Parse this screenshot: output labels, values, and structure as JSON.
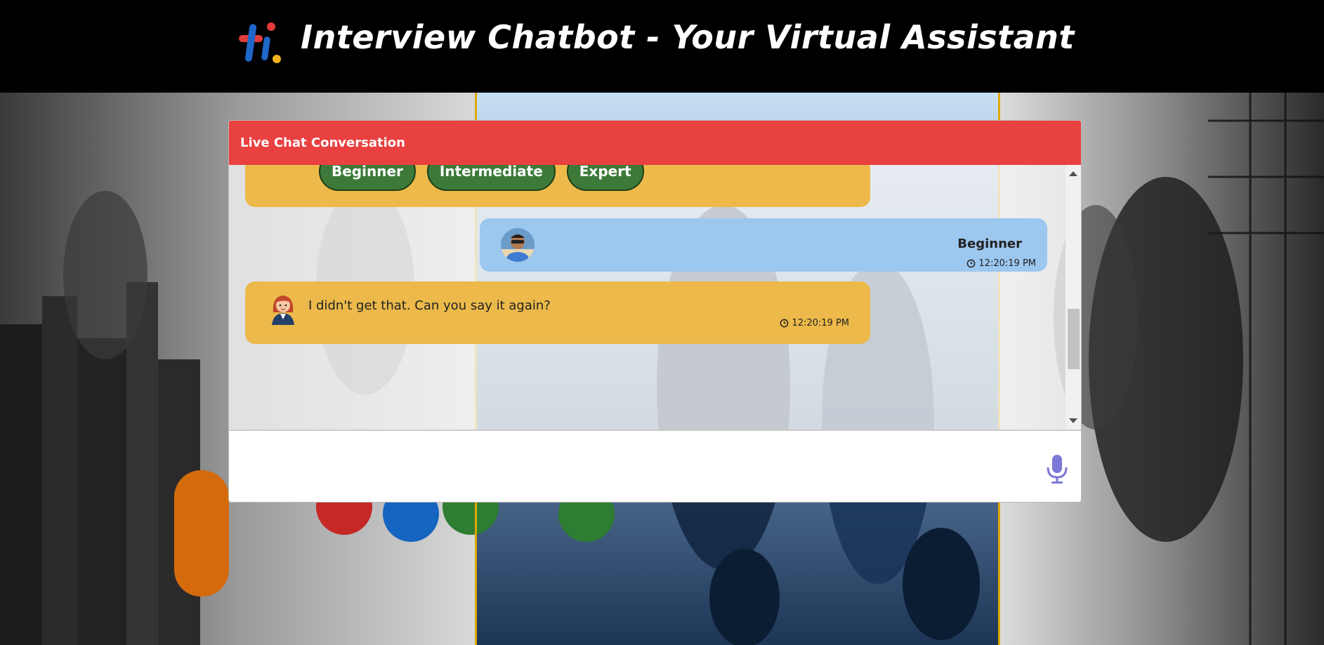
{
  "header": {
    "title": "Interview Chatbot - Your Virtual Assistant"
  },
  "chat": {
    "header_label": "Live Chat Conversation",
    "options": [
      {
        "label": "Beginner"
      },
      {
        "label": "Intermediate"
      },
      {
        "label": "Expert"
      }
    ],
    "messages": [
      {
        "sender": "user",
        "text": "Beginner",
        "time": "12:20:19 PM"
      },
      {
        "sender": "bot",
        "text": "I didn't get that. Can you say it again?",
        "time": "12:20:19 PM"
      }
    ],
    "input": {
      "value": "",
      "placeholder": ""
    }
  },
  "colors": {
    "header_bg": "#000000",
    "chat_header": "#e94040",
    "bot_bubble": "#ecb94a",
    "user_bubble": "#9cc7ef",
    "option_button": "#3d7a3a",
    "mic_icon": "#7b78d6"
  },
  "icons": {
    "logo": "hi-logo",
    "clock": "clock-icon",
    "mic": "microphone-icon",
    "bot_avatar": "woman-agent-avatar",
    "user_avatar": "user-photo-avatar"
  }
}
